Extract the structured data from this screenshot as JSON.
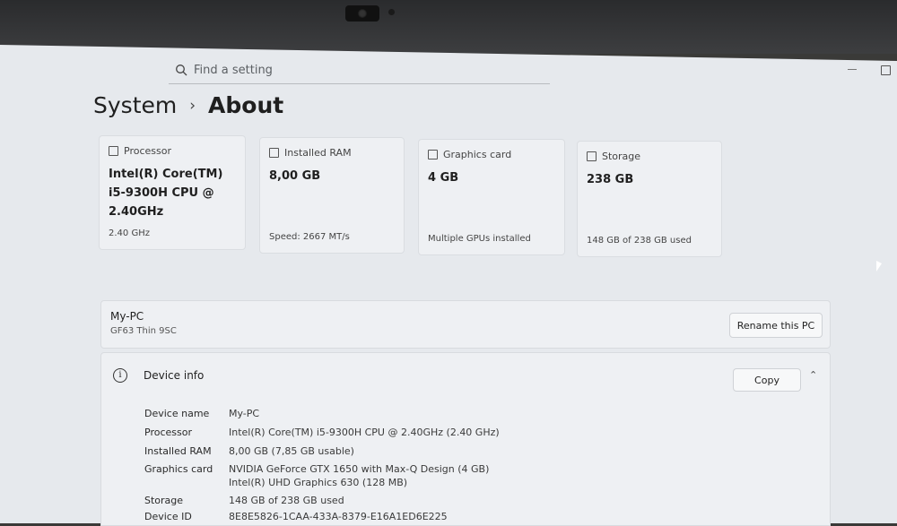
{
  "search": {
    "placeholder": "Find a setting"
  },
  "breadcrumb": {
    "parent": "System",
    "separator": "›",
    "current": "About"
  },
  "cards": [
    {
      "label": "Processor",
      "value": "Intel(R) Core(TM) i5-9300H CPU @ 2.40GHz",
      "sub": "2.40 GHz",
      "icon": "processor-icon"
    },
    {
      "label": "Installed RAM",
      "value": "8,00 GB",
      "sub": "Speed: 2667 MT/s",
      "icon": "ram-icon"
    },
    {
      "label": "Graphics card",
      "value": "4 GB",
      "sub": "Multiple GPUs installed",
      "icon": "graphics-card-icon"
    },
    {
      "label": "Storage",
      "value": "238 GB",
      "sub": "148 GB of 238 GB used",
      "icon": "storage-icon"
    }
  ],
  "pc": {
    "name": "My-PC",
    "model": "GF63 Thin 9SC",
    "rename_label": "Rename this PC"
  },
  "device_info": {
    "title": "Device info",
    "copy_label": "Copy",
    "rows": [
      {
        "key": "Device name",
        "value": "My-PC"
      },
      {
        "key": "Processor",
        "value": "Intel(R) Core(TM) i5-9300H CPU @ 2.40GHz (2.40 GHz)"
      },
      {
        "key": "Installed RAM",
        "value": "8,00 GB (7,85 GB usable)"
      },
      {
        "key": "Graphics card",
        "value": "NVIDIA GeForce GTX 1650 with Max-Q Design (4 GB)",
        "value2": "Intel(R) UHD Graphics 630 (128 MB)"
      },
      {
        "key": "Storage",
        "value": "148 GB of 238 GB used"
      },
      {
        "key": "Device ID",
        "value": "8E8E5826-1CAA-433A-8379-E16A1ED6E225"
      }
    ]
  }
}
